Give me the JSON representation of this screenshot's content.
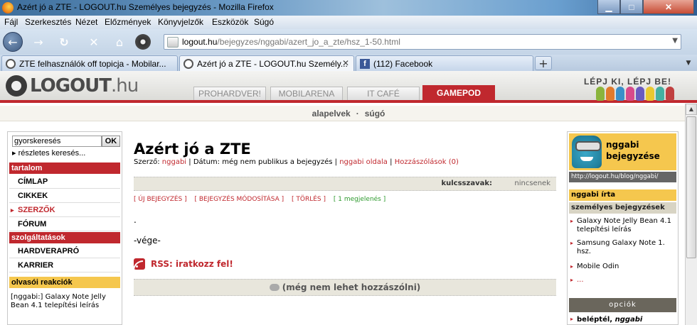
{
  "window": {
    "title": "Azért jó a ZTE - LOGOUT.hu Személyes bejegyzés - Mozilla Firefox"
  },
  "menu": [
    "Fájl",
    "Szerkesztés",
    "Nézet",
    "Előzmények",
    "Könyvjelzők",
    "Eszközök",
    "Súgó"
  ],
  "nav": {
    "url_host": "logout.hu",
    "url_path": "/bejegyzes/nggabi/azert_jo_a_zte/hsz_1-50.html"
  },
  "tabs": [
    {
      "label": "ZTE felhasználók off topicja - Mobilar...",
      "icon": "logout-favicon"
    },
    {
      "label": "Azért jó a ZTE - LOGOUT.hu Személy...",
      "icon": "logout-favicon",
      "active": true
    },
    {
      "label": "(112) Facebook",
      "icon": "facebook-favicon"
    }
  ],
  "site": {
    "logo": "LOGOUT",
    "logo_suffix": ".hu",
    "tabs": [
      "PROHARDVER!",
      "MOBILARENA",
      "IT CAFÉ",
      "GAMEPOD"
    ],
    "slogan": "LÉPJ KI, LÉPJ BE!",
    "subnav": [
      "alapelvek",
      "súgó"
    ],
    "subnav_sep": "·"
  },
  "left": {
    "search_value": "gyorskeresés",
    "search_btn": "OK",
    "adv_search": "▸ részletes keresés...",
    "sec_tartalom": "tartalom",
    "items1": [
      "CÍMLAP",
      "CIKKEK",
      "SZERZŐK",
      "FÓRUM"
    ],
    "sec_szolg": "szolgáltatások",
    "items2": [
      "HARDVERAPRÓ",
      "KARRIER"
    ],
    "sec_react": "olvasói reakciók",
    "react_text": "[nggabi:] Galaxy Note Jelly Bean 4.1 telepítési leírás"
  },
  "main": {
    "title": "Azért jó a ZTE",
    "meta": {
      "author_label": "Szerző:",
      "author": "nggabi",
      "date_label": "| Dátum: még nem publikus a bejegyzés |",
      "page_link": "nggabi oldala",
      "sep": "|",
      "comments": "Hozzászólások (0)"
    },
    "kw_label": "kulcsszavak:",
    "kw_value": "nincsenek",
    "actions": [
      "[ ÚJ BEJEGYZÉS ]",
      "[ BEJEGYZÉS MÓDOSÍTÁSA ]",
      "[ TÖRLÉS ]"
    ],
    "views": "[ 1 megjelenés ]",
    "dot": ".",
    "end": "-vége-",
    "rss": "RSS: iratkozz fel!",
    "comment_bar": "(még nem lehet hozzászólni)"
  },
  "right": {
    "name": "nggabi",
    "subtitle": "bejegyzése",
    "url": "http://logout.hu/blog/nggabi/",
    "irta": "nggabi írta",
    "sec": "személyes bejegyzések",
    "items": [
      "Galaxy Note Jelly Bean 4.1 telepítési leírás",
      "Samsung Galaxy Note 1. hsz.",
      "Mobile Odin",
      "..."
    ],
    "opciok": "opciók",
    "login": "beléptél,",
    "login_user": "nggabi"
  },
  "colors": {
    "accent": "#c0282e",
    "gold": "#f5c74e"
  }
}
